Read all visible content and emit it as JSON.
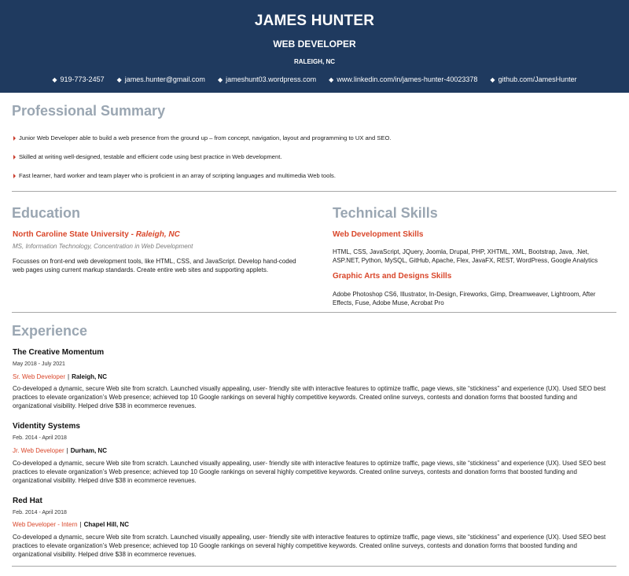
{
  "header": {
    "name": "JAMES HUNTER",
    "title": "WEB DEVELOPER",
    "location": "RALEIGH, NC",
    "contacts": [
      "919-773-2457",
      "james.hunter@gmail.com",
      "jameshunt03.wordpress.com",
      "www.linkedin.com/in/james-hunter-40023378",
      "github.com/JamesHunter"
    ]
  },
  "summary": {
    "title": "Professional Summary",
    "bullets": [
      "Junior Web Developer able to build a web presence from the ground up – from concept, navigation, layout and programming to UX and SEO.",
      "Skilled at writing well-designed, testable and efficient code using best practice in Web development.",
      "Fast learner, hard worker and team player who is proficient in an array of scripting languages and multimedia Web tools."
    ]
  },
  "education": {
    "title": "Education",
    "school": "North Caroline State University - ",
    "school_location": "Raleigh, NC",
    "degree": "MS, Information Technology, Concentration in Web Development",
    "description": "Focusses on front-end web development tools, like HTML, CSS, and JavaScript. Develop hand-coded web pages using current markup standards. Create entire web sites and supporting applets."
  },
  "skills": {
    "title": "Technical Skills",
    "groups": [
      {
        "name": "Web Development Skills",
        "items": "HTML, CSS, JavaScript, JQuery, Joomla, Drupal, PHP, XHTML, XML, Bootstrap, Java, .Net, ASP.NET, Python, MySQL, GitHub, Apache, Flex, JavaFX, REST, WordPress, Google Analytics"
      },
      {
        "name": "Graphic Arts and Designs Skills",
        "items": "Adobe Photoshop CS6, Illustrator, In-Design, Fireworks, Gimp, Dreamweaver, Lightroom, After Effects, Fuse, Adobe Muse, Acrobat Pro"
      }
    ]
  },
  "experience": {
    "title": "Experience",
    "jobs": [
      {
        "company": "The Creative Momentum",
        "dates": "May 2018 - July 2021",
        "role": "Sr. Web Developer",
        "sep": "|",
        "place": "Raleigh, NC",
        "description": "Co-developed a dynamic, secure Web site from scratch. Launched visually appealing, user- friendly site with interactive features to optimize traffic, page views, site “stickiness” and experience (UX). Used SEO best practices to elevate organization’s Web presence; achieved top 10 Google rankings on several highly competitive keywords. Created online surveys, contests and donation forms that boosted funding and organizational visibility. Helped drive $38 in ecommerce revenues."
      },
      {
        "company": "Videntity Systems",
        "dates": "Feb. 2014 - April 2018",
        "role": "Jr. Web Developer",
        "sep": "|",
        "place": "Durham, NC",
        "description": "Co-developed a dynamic, secure Web site from scratch. Launched visually appealing, user- friendly site with interactive features to optimize traffic, page views, site “stickiness” and experience (UX). Used SEO best practices to elevate organization’s Web presence; achieved top 10 Google rankings on several highly competitive keywords. Created online surveys, contests and donation forms that boosted funding and organizational visibility. Helped drive $38 in ecommerce revenues."
      },
      {
        "company": "Red Hat",
        "dates": "Feb. 2014 - April 2018",
        "role": "Web Developer - Intern",
        "sep": "|",
        "place": "Chapel Hill, NC",
        "description": "Co-developed a dynamic, secure Web site from scratch. Launched visually appealing, user- friendly site with interactive features to optimize traffic, page views, site “stickiness” and experience (UX). Used SEO best practices to elevate organization’s Web presence; achieved top 10 Google rankings on several highly competitive keywords. Created online surveys, contests and donation forms that boosted funding and organizational visibility. Helped drive $38 in ecommerce revenues."
      }
    ]
  }
}
